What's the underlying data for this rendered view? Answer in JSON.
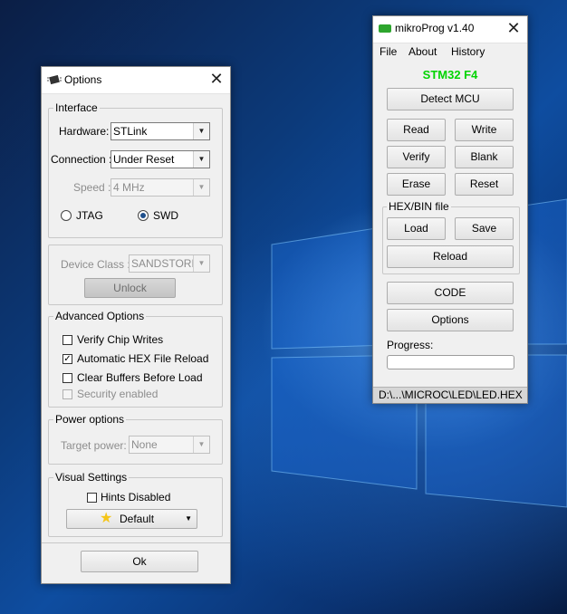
{
  "options_window": {
    "title": "Options",
    "close": "✕",
    "interface": {
      "label": "Interface",
      "hardware_label": "Hardware:",
      "hardware_value": "STLink",
      "connection_label": "Connection :",
      "connection_value": "Under Reset",
      "speed_label": "Speed :",
      "speed_value": "4 MHz",
      "jtag_label": "JTAG",
      "swd_label": "SWD",
      "selected_protocol": "SWD"
    },
    "device": {
      "class_label": "Device Class :",
      "class_value": "SANDSTORM",
      "unlock_label": "Unlock"
    },
    "advanced": {
      "label": "Advanced Options",
      "items": [
        {
          "label": "Verify Chip Writes",
          "checked": false,
          "disabled": false
        },
        {
          "label": "Automatic HEX File Reload",
          "checked": true,
          "disabled": false
        },
        {
          "label": "Clear Buffers Before Load",
          "checked": false,
          "disabled": false
        },
        {
          "label": "Security enabled",
          "checked": false,
          "disabled": true
        }
      ]
    },
    "power": {
      "label": "Power options",
      "target_label": "Target power:",
      "target_value": "None"
    },
    "visual": {
      "label": "Visual Settings",
      "hints_label": "Hints Disabled",
      "default_label": "Default"
    },
    "ok_label": "Ok"
  },
  "mikroprog_window": {
    "title": "mikroProg v1.40",
    "close": "✕",
    "menu": [
      "File",
      "About",
      "History"
    ],
    "mcu": "STM32 F4",
    "detect_label": "Detect MCU",
    "buttons": {
      "read": "Read",
      "write": "Write",
      "verify": "Verify",
      "blank": "Blank",
      "erase": "Erase",
      "reset": "Reset"
    },
    "hexbin": {
      "label": "HEX/BIN file",
      "load": "Load",
      "save": "Save",
      "reload": "Reload"
    },
    "code_label": "CODE",
    "options_label": "Options",
    "progress_label": "Progress:",
    "progress": 0,
    "status_path": "D:\\...\\MICROC\\LED\\LED.HEX"
  },
  "colors": {
    "mcu_text": "#00d400",
    "radio_selected": "#1e4f8c",
    "default_star": "#f5c518"
  }
}
